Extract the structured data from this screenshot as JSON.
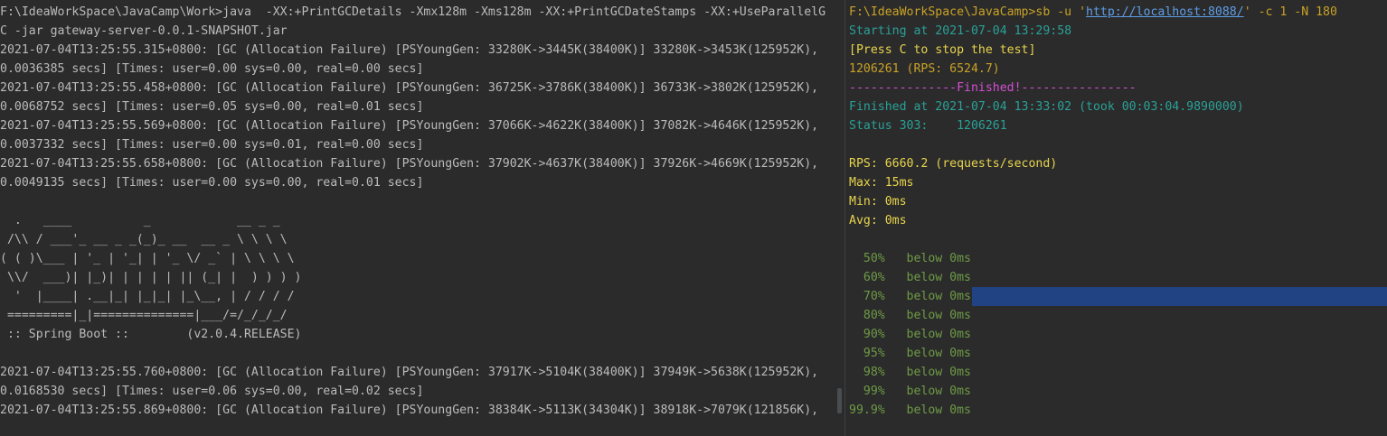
{
  "left_terminal": {
    "lines": [
      "F:\\IdeaWorkSpace\\JavaCamp\\Work>java  -XX:+PrintGCDetails -Xmx128m -Xms128m -XX:+PrintGCDateStamps -XX:+UseParallelG",
      "C -jar gateway-server-0.0.1-SNAPSHOT.jar",
      "2021-07-04T13:25:55.315+0800: [GC (Allocation Failure) [PSYoungGen: 33280K->3445K(38400K)] 33280K->3453K(125952K),",
      "0.0036385 secs] [Times: user=0.00 sys=0.00, real=0.00 secs]",
      "2021-07-04T13:25:55.458+0800: [GC (Allocation Failure) [PSYoungGen: 36725K->3786K(38400K)] 36733K->3802K(125952K),",
      "0.0068752 secs] [Times: user=0.05 sys=0.00, real=0.01 secs]",
      "2021-07-04T13:25:55.569+0800: [GC (Allocation Failure) [PSYoungGen: 37066K->4622K(38400K)] 37082K->4646K(125952K),",
      "0.0037332 secs] [Times: user=0.00 sys=0.01, real=0.00 secs]",
      "2021-07-04T13:25:55.658+0800: [GC (Allocation Failure) [PSYoungGen: 37902K->4637K(38400K)] 37926K->4669K(125952K),",
      "0.0049135 secs] [Times: user=0.00 sys=0.00, real=0.01 secs]",
      "",
      "  .   ____          _            __ _ _",
      " /\\\\ / ___'_ __ _ _(_)_ __  __ _ \\ \\ \\ \\",
      "( ( )\\___ | '_ | '_| | '_ \\/ _` | \\ \\ \\ \\",
      " \\\\/  ___)| |_)| | | | | || (_| |  ) ) ) )",
      "  '  |____| .__|_| |_|_| |_\\__, | / / / /",
      " =========|_|==============|___/=/_/_/_/",
      " :: Spring Boot ::        (v2.0.4.RELEASE)",
      "",
      "2021-07-04T13:25:55.760+0800: [GC (Allocation Failure) [PSYoungGen: 37917K->5104K(38400K)] 37949K->5638K(125952K),",
      "0.0168530 secs] [Times: user=0.06 sys=0.00, real=0.02 secs]",
      "2021-07-04T13:25:55.869+0800: [GC (Allocation Failure) [PSYoungGen: 38384K->5113K(34304K)] 38918K->7079K(121856K),"
    ]
  },
  "right_terminal": {
    "prompt": "F:\\IdeaWorkSpace\\JavaCamp>sb -u '",
    "url": "http://localhost:8088/",
    "command_tail": "' -c 1 -N 180",
    "starting": "Starting at 2021-07-04 13:29:58",
    "press_c": "[Press C to stop the test]",
    "progress": "1206261 (RPS: 6524.7)",
    "finished_banner": "---------------Finished!----------------",
    "finished_at": "Finished at 2021-07-04 13:33:02 (took 00:03:04.9890000)",
    "status": "Status 303:    1206261",
    "rps": "RPS: 6660.2 (requests/second)",
    "max": "Max: 15ms",
    "min": "Min: 0ms",
    "avg": "Avg: 0ms",
    "percentiles": [
      "  50%   below 0ms",
      "  60%   below 0ms",
      "  70%   below 0ms",
      "  80%   below 0ms",
      "  90%   below 0ms",
      "  95%   below 0ms",
      "  98%   below 0ms",
      "  99%   below 0ms",
      "99.9%   below 0ms"
    ]
  },
  "colors": {
    "background": "#2b2b2b",
    "text": "#bbbbbb",
    "teal": "#2aa198",
    "yellow": "#e8d44d",
    "magenta": "#d34fd3",
    "green": "#6e9b45",
    "selection": "#214283"
  }
}
